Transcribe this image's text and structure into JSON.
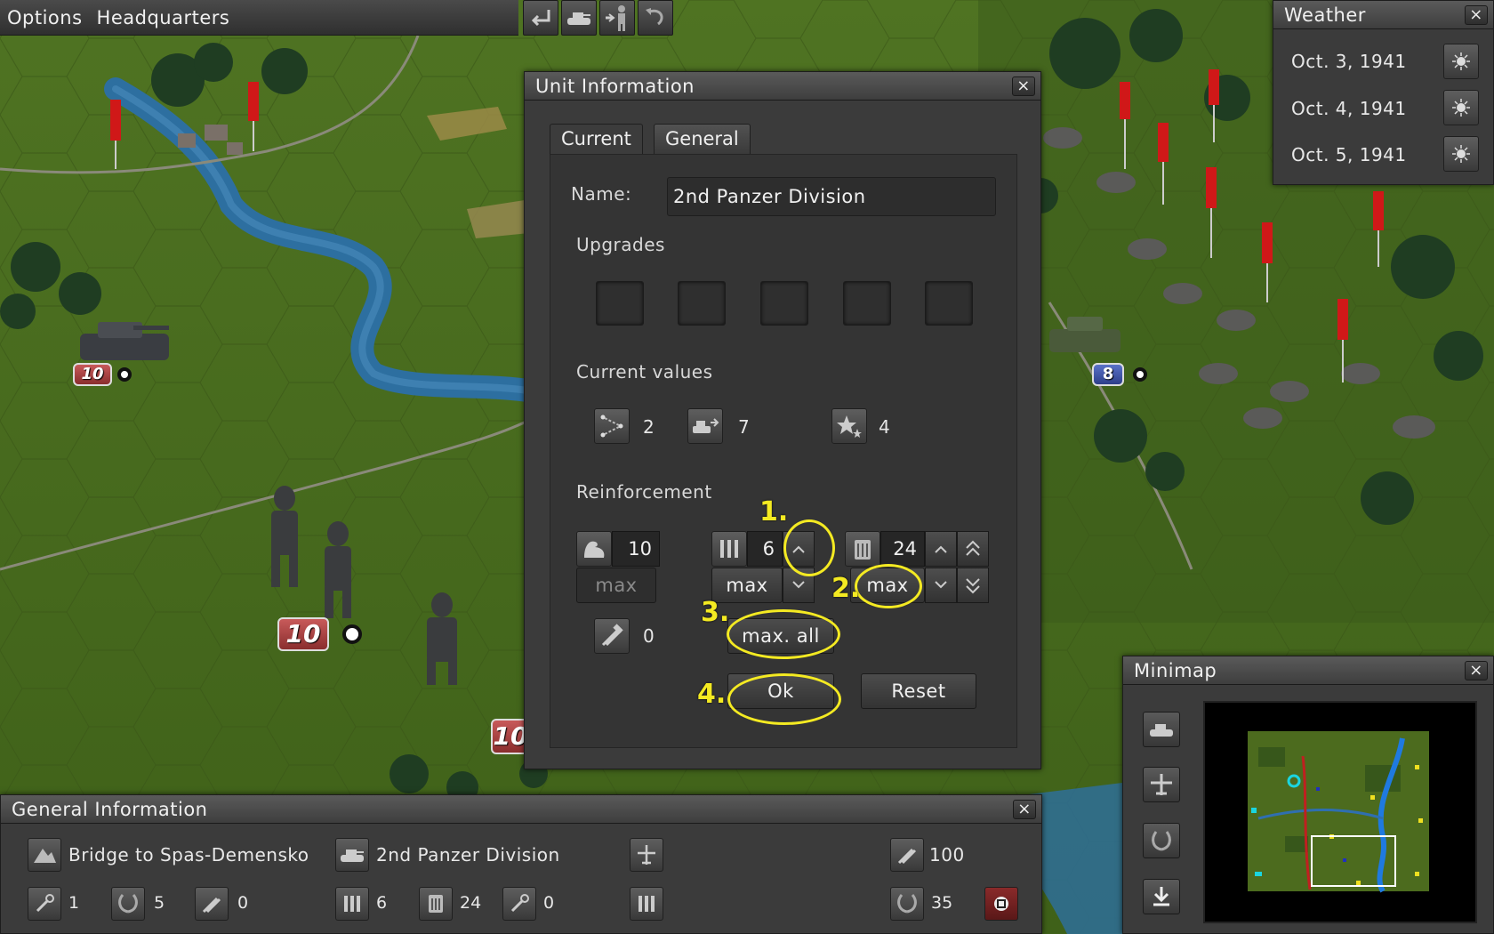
{
  "menu": {
    "options": "Options",
    "headquarters": "Headquarters"
  },
  "toolbar": {
    "icons": [
      "return-icon",
      "tank-icon",
      "soldier-icon",
      "undo-icon"
    ]
  },
  "unit_info": {
    "title": "Unit Information",
    "close": "×",
    "tabs": {
      "current": "Current",
      "general": "General"
    },
    "name_label": "Name:",
    "name_value": "2nd Panzer Division",
    "upgrades_label": "Upgrades",
    "current_values_label": "Current values",
    "current_values": {
      "movement": "2",
      "attack": "7",
      "experience": "4"
    },
    "reinforcement_label": "Reinforcement",
    "strength": {
      "value": "10",
      "max_label": "max"
    },
    "ammo": {
      "value": "6",
      "max_label": "max"
    },
    "fuel": {
      "value": "24",
      "max_label": "max"
    },
    "repair": {
      "value": "0"
    },
    "max_all_label": "max. all",
    "ok_label": "Ok",
    "reset_label": "Reset",
    "annotations": [
      "1.",
      "2.",
      "3.",
      "4."
    ],
    "highlight_color": "#f4ea22"
  },
  "weather": {
    "title": "Weather",
    "close": "×",
    "days": [
      {
        "date": "Oct. 3, 1941",
        "icon": "sun-icon"
      },
      {
        "date": "Oct. 4, 1941",
        "icon": "sun-icon"
      },
      {
        "date": "Oct. 5, 1941",
        "icon": "sun-icon"
      }
    ]
  },
  "minimap": {
    "title": "Minimap",
    "close": "×",
    "buttons": [
      "tank-icon",
      "plane-icon",
      "laurel-icon",
      "download-icon"
    ]
  },
  "general_info": {
    "title": "General Information",
    "close": "×",
    "location": "Bridge to Spas-Demensko",
    "unit_name": "2nd Panzer Division",
    "stat_100": "100",
    "row2": {
      "a": "1",
      "b": "5",
      "c": "0",
      "ammo": "6",
      "fuel": "24",
      "d": "0",
      "e": "35"
    }
  },
  "map_units": [
    {
      "faction": "german",
      "strength": "10"
    },
    {
      "faction": "german",
      "strength": "10"
    },
    {
      "faction": "german",
      "strength": "10"
    },
    {
      "faction": "soviet",
      "strength": "8"
    }
  ],
  "colors": {
    "german_badge": "#a84444",
    "soviet_badge": "#3e55a8",
    "soviet_flag": "#d01818",
    "river": "#2d6fa0"
  }
}
